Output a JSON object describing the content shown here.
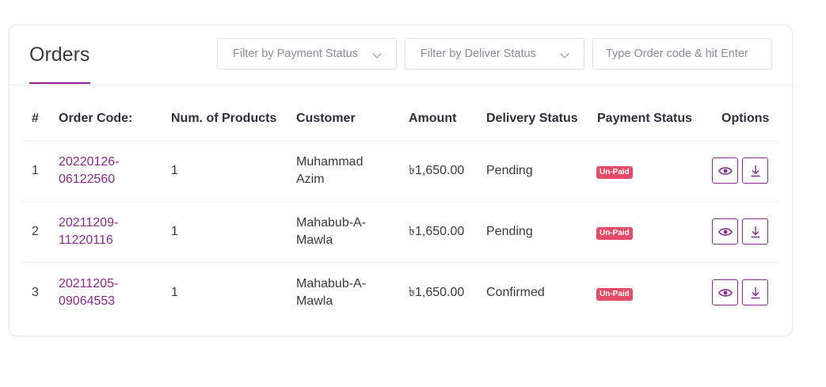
{
  "header": {
    "title": "Orders",
    "payment_filter_label": "Filter by Payment Status",
    "delivery_filter_label": "Filter by Deliver Status",
    "search_placeholder": "Type Order code & hit Enter"
  },
  "table": {
    "columns": [
      "#",
      "Order Code:",
      "Num. of Products",
      "Customer",
      "Amount",
      "Delivery Status",
      "Payment Status",
      "Options"
    ],
    "rows": [
      {
        "index": "1",
        "code_line1": "20220126-",
        "code_line2": "06122560",
        "products": "1",
        "customer_line1": "Muhammad",
        "customer_line2": "Azim",
        "amount": "৳1,650.00",
        "delivery": "Pending",
        "payment": "Un-Paid"
      },
      {
        "index": "2",
        "code_line1": "20211209-",
        "code_line2": "11220116",
        "products": "1",
        "customer_line1": "Mahabub-A-",
        "customer_line2": "Mawla",
        "amount": "৳1,650.00",
        "delivery": "Pending",
        "payment": "Un-Paid"
      },
      {
        "index": "3",
        "code_line1": "20211205-",
        "code_line2": "09064553",
        "products": "1",
        "customer_line1": "Mahabub-A-",
        "customer_line2": "Mawla",
        "amount": "৳1,650.00",
        "delivery": "Confirmed",
        "payment": "Un-Paid"
      }
    ],
    "row_actions": [
      {
        "name": "view",
        "icon": "eye-icon"
      },
      {
        "name": "download",
        "icon": "download-icon"
      }
    ]
  },
  "colors": {
    "accent": "#8a2a8e",
    "unpaid_badge": "#e34b67"
  }
}
